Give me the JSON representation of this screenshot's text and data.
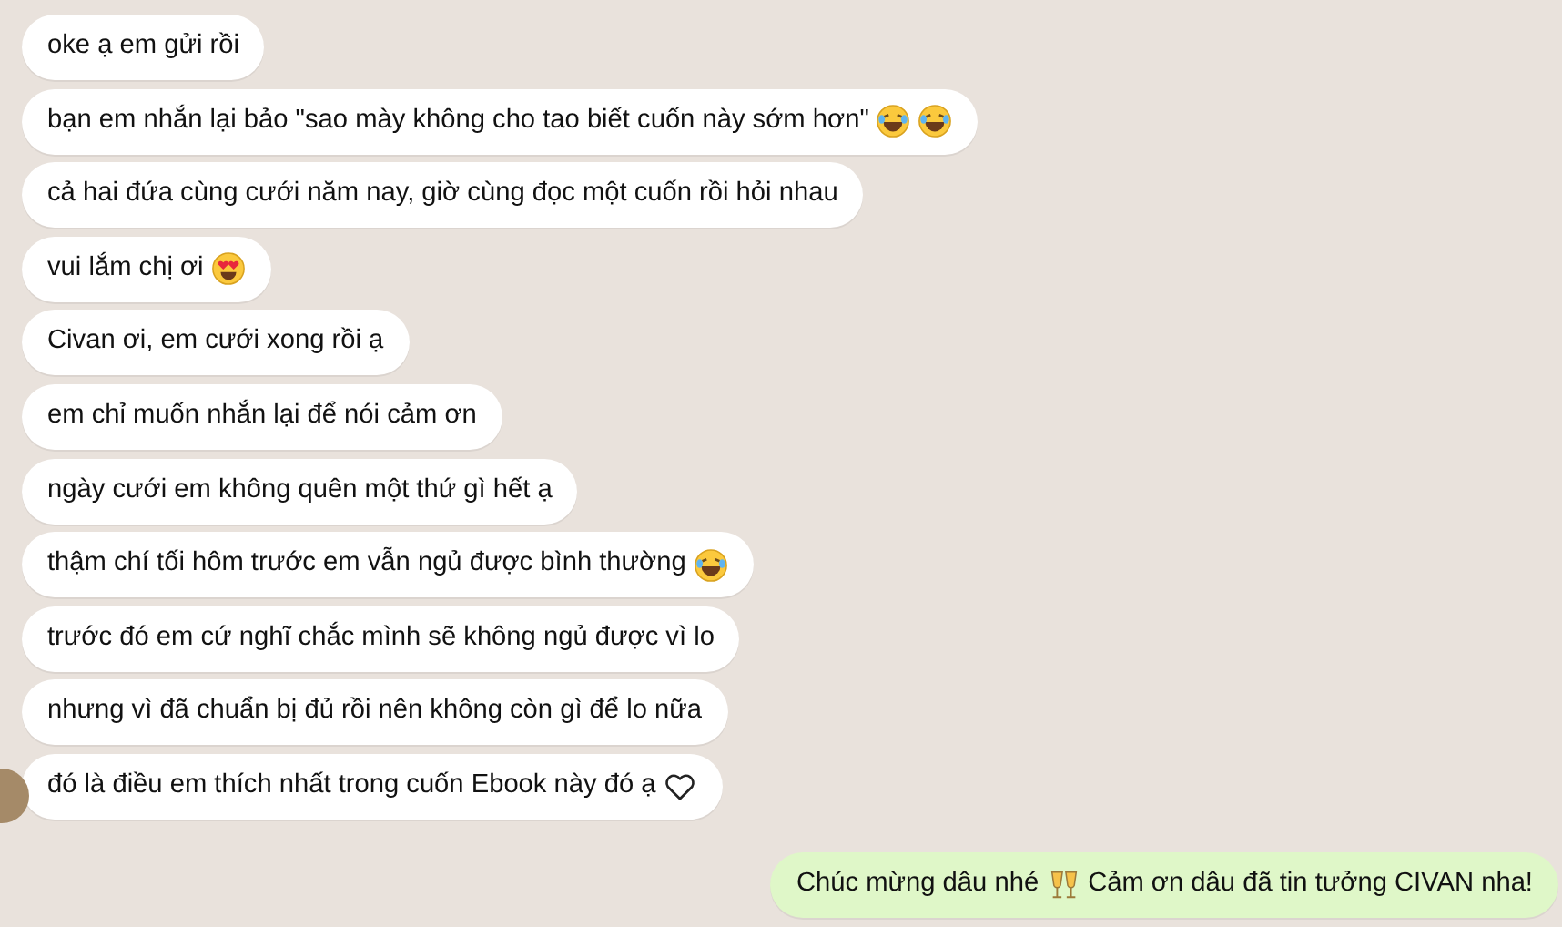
{
  "messages": [
    {
      "outgoing": false,
      "show_avatar": false,
      "parts": [
        {
          "kind": "text",
          "text": "oke ạ em gửi rồi"
        }
      ]
    },
    {
      "outgoing": false,
      "show_avatar": false,
      "parts": [
        {
          "kind": "text",
          "text": "bạn em nhắn lại bảo \"sao mày không cho tao biết cuốn này sớm hơn\""
        },
        {
          "kind": "laughing"
        },
        {
          "kind": "laughing"
        }
      ]
    },
    {
      "outgoing": false,
      "show_avatar": false,
      "parts": [
        {
          "kind": "text",
          "text": "cả hai đứa cùng cưới năm nay, giờ cùng đọc một cuốn rồi hỏi nhau"
        }
      ]
    },
    {
      "outgoing": false,
      "show_avatar": false,
      "parts": [
        {
          "kind": "text",
          "text": "vui lắm chị ơi"
        },
        {
          "kind": "heart-eyes"
        }
      ]
    },
    {
      "outgoing": false,
      "show_avatar": false,
      "parts": [
        {
          "kind": "text",
          "text": "Civan ơi, em cưới xong rồi ạ"
        }
      ]
    },
    {
      "outgoing": false,
      "show_avatar": false,
      "parts": [
        {
          "kind": "text",
          "text": "em chỉ muốn nhắn lại để nói cảm ơn"
        }
      ]
    },
    {
      "outgoing": false,
      "show_avatar": false,
      "parts": [
        {
          "kind": "text",
          "text": "ngày cưới em không quên một thứ gì hết ạ"
        }
      ]
    },
    {
      "outgoing": false,
      "show_avatar": false,
      "parts": [
        {
          "kind": "text",
          "text": "thậm chí tối hôm trước em vẫn ngủ được bình thường"
        },
        {
          "kind": "laughing"
        }
      ]
    },
    {
      "outgoing": false,
      "show_avatar": false,
      "parts": [
        {
          "kind": "text",
          "text": "trước đó em cứ nghĩ chắc mình sẽ không ngủ được vì lo"
        }
      ]
    },
    {
      "outgoing": false,
      "show_avatar": false,
      "parts": [
        {
          "kind": "text",
          "text": "nhưng vì đã chuẩn bị đủ rồi nên không còn gì để lo nữa"
        }
      ]
    },
    {
      "outgoing": false,
      "show_avatar": true,
      "parts": [
        {
          "kind": "text",
          "text": "đó là điều em thích nhất trong cuốn Ebook này đó ạ"
        },
        {
          "kind": "heart"
        }
      ]
    },
    {
      "outgoing": true,
      "show_avatar": false,
      "parts": [
        {
          "kind": "text",
          "text": "Chúc mừng dâu nhé"
        },
        {
          "kind": "cheers"
        },
        {
          "kind": "text",
          "text": "Cảm ơn dâu đã tin tưởng CIVAN nha!"
        }
      ]
    }
  ]
}
